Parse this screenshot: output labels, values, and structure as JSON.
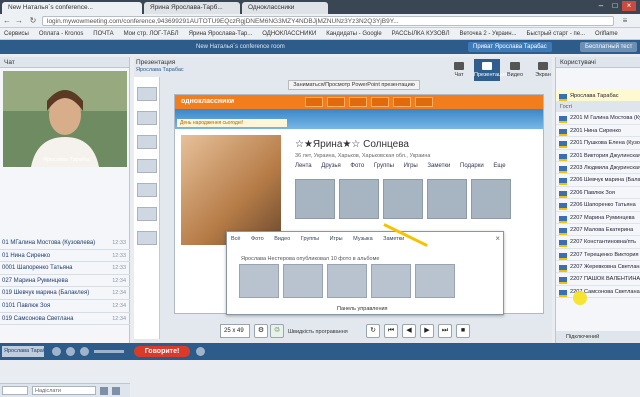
{
  "browser": {
    "tabs": [
      "New Наталья`s conference...",
      "Ярина Ярослава-Тарб...",
      "Одноклассники"
    ],
    "url": "login.mywowmeeting.com/conference,943699291AUTOTU9EQczRgjDNEM6NG3MZY4NDBJjMZNUNz3Yz3N2Q3YjB9Y..."
  },
  "bookmarks": [
    "Сервисы",
    "Оплата - Кrолos",
    "ПОЧТА",
    "Мои стр. ЛОГ-ТАБЛ",
    "Ярина Ярослава-Тар...",
    "ОДНОКЛАССНИКИ",
    "Кандидаты - Google",
    "РАССЫЛКА КУЗОВЛ",
    "Веточка 2 - Украин...",
    "Быстрый старт - пе...",
    "Oriflame"
  ],
  "appbar": {
    "title": "New Наталья`s conference room",
    "invite_button": "Приват Ярослава Тарабас",
    "free_button": "Бесплатный тест"
  },
  "left_panel": {
    "title": "Чат",
    "video_caption": "Ярослава Тарабас",
    "chat": [
      {
        "name": "01 МГалина Мостова (Кузовлева)",
        "time": "12:33"
      },
      {
        "name": "01 Нина Сиренко",
        "time": "12:33"
      },
      {
        "name": "0001 Шапоренко Татьяна",
        "time": "12:33"
      },
      {
        "name": "027 Марина Руминцева",
        "time": "12:34"
      },
      {
        "name": "019 Шевчук марина (Балаклея)",
        "time": "12:34"
      },
      {
        "name": "0101 Павлюк Зоя",
        "time": "12:34"
      },
      {
        "name": "019 Самсонова Светлана",
        "time": "12:34"
      }
    ],
    "chat_input_placeholder": "Надіслати"
  },
  "center": {
    "header": "Презентация",
    "presenter": "Ярослава Тарабас",
    "view_tabs": [
      "Чат",
      "Презентация",
      "Видео",
      "Экран"
    ],
    "banner": "Заниматься/Просмотр PowerPoint презентацию",
    "profile": {
      "name": "☆★Ярина★☆ Солнцева",
      "meta": "36 лет, Украина, Харьков, Харьковская обл., Украина",
      "menu": [
        "Лента",
        "Друзья",
        "Фото",
        "Группы",
        "Игры",
        "Заметки",
        "Подарки",
        "Еще"
      ],
      "ok_logo": "одноклассники",
      "birthday_strip": "День народження сьогодні!"
    },
    "popup": {
      "tabs": [
        "Всё",
        "Фото",
        "Видео",
        "Группы",
        "Игры",
        "Музыка",
        "Заметки"
      ],
      "author": "Ярослава Нестерова опубликовал 10 фото в альбоме",
      "footer": "Панель управления",
      "close": "×"
    },
    "zoom": "25 x 49",
    "speed_label": "Швидкість програвання"
  },
  "right_panel": {
    "title": "Користувачі",
    "host": "Ярослава Тарабас",
    "section": "Гості",
    "users": [
      "2201 М Галина Мостова (Кузов",
      "2201 Нина Сиренко",
      "2201 Пушкова Елена (Кузо",
      "2201 Виктория Джулинская",
      "2203 Людмила Джуринская",
      "2206 Шевчук марина (Балак",
      "2206 Павлюк Зоя",
      "2206 Шапоренко Татьяна",
      "2207 Марина Руминцева",
      "2207 Малова Екатерина",
      "2207 Константиновна/пть",
      "2207 Терещенко Виктория",
      "2207 Жеревковна Светлана",
      "2207 ПАШОК ВАЛЕНТИНА",
      "2207 Самсонова Светлана"
    ],
    "footer": "Підключений"
  },
  "bottom_bar": {
    "self_name": "Ярослава Тарабас",
    "talk_button": "Говорите!"
  }
}
